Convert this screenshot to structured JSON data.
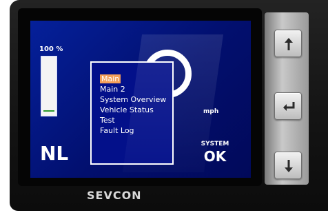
{
  "display": {
    "charge_label": "100 %",
    "charge_level": 1.0,
    "gear": "NL",
    "speed_unit": "mph",
    "system_label": "SYSTEM",
    "system_state": "OK"
  },
  "menu": {
    "items": [
      {
        "label": "Main",
        "selected": true
      },
      {
        "label": "Main 2",
        "selected": false
      },
      {
        "label": "System Overview",
        "selected": false
      },
      {
        "label": "Vehicle Status",
        "selected": false
      },
      {
        "label": "Test",
        "selected": false
      },
      {
        "label": "Fault Log",
        "selected": false
      }
    ]
  },
  "device": {
    "brand": "SEVCON"
  },
  "buttons": {
    "up_icon": "arrow-up-icon",
    "enter_icon": "enter-icon",
    "down_icon": "arrow-down-icon"
  },
  "colors": {
    "screen_bg": "#03108a",
    "menu_highlight": "#f5a05a",
    "gauge_marker": "#2b9a2b"
  }
}
